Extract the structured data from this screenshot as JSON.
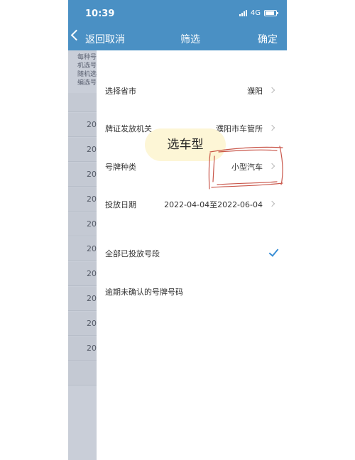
{
  "status": {
    "time": "10:39",
    "network": "4G"
  },
  "header": {
    "back_label": "返回",
    "cancel": "取消",
    "title": "筛选",
    "confirm": "确定"
  },
  "background_list": {
    "notes": [
      "每种号",
      "机选号",
      "随机选",
      "编选号"
    ],
    "row_years": [
      "20",
      "20",
      "20",
      "20",
      "20",
      "20",
      "20",
      "20",
      "20",
      "20"
    ]
  },
  "filters": [
    {
      "label": "选择省市",
      "value": "濮阳"
    },
    {
      "label": "牌证发放机关",
      "value": "濮阳市车管所"
    },
    {
      "label": "号牌种类",
      "value": "小型汽车"
    },
    {
      "label": "投放日期",
      "value": "2022-04-04至2022-06-04"
    }
  ],
  "options": [
    {
      "label": "全部已投放号段",
      "checked": true
    },
    {
      "label": "逾期未确认的号牌号码",
      "checked": false
    }
  ],
  "annotation": {
    "bubble_text": "选车型",
    "scribble_color": "#c0392b",
    "bubble_color": "#fdf6d6"
  },
  "colors": {
    "header": "#4a90c4",
    "check": "#3a8fd6"
  }
}
